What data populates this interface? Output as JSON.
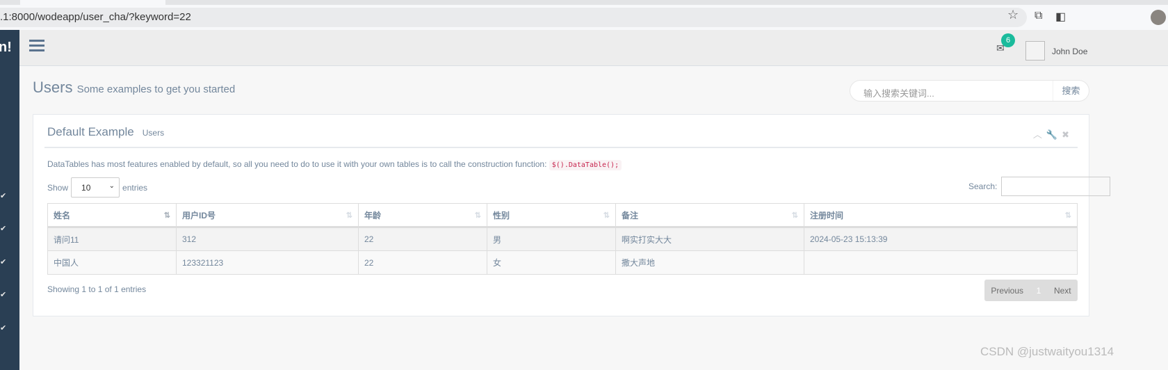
{
  "browser": {
    "url": ".1:8000/wodeapp/user_cha/?keyword=22"
  },
  "sidebar": {
    "brand": "n!",
    "check": "✔"
  },
  "topnav": {
    "mail_count": "6",
    "user_name": "John Doe"
  },
  "page": {
    "title": "Users",
    "subtitle": "Some examples to get you started",
    "search_placeholder": "输入搜索关键词...",
    "search_button": "搜索"
  },
  "panel": {
    "title": "Default Example",
    "subtitle": "Users",
    "description": "DataTables has most features enabled by default, so all you need to do to use it with your own tables is to call the construction function:",
    "code": "$().DataTable();",
    "show_label": "Show",
    "length_value": "10",
    "entries_label": "entries",
    "search_label": "Search:",
    "columns": [
      "姓名",
      "用户ID号",
      "年龄",
      "性别",
      "备注",
      "注册时间"
    ],
    "rows": [
      [
        "请问11",
        "312",
        "22",
        "男",
        "啊实打实大大",
        "2024-05-23 15:13:39"
      ],
      [
        "中国人",
        "123321123",
        "22",
        "女",
        "撒大声地",
        ""
      ]
    ],
    "info": "Showing 1 to 1 of 1 entries",
    "prev": "Previous",
    "page": "1",
    "next": "Next"
  },
  "watermark": "CSDN @justwaityou1314"
}
